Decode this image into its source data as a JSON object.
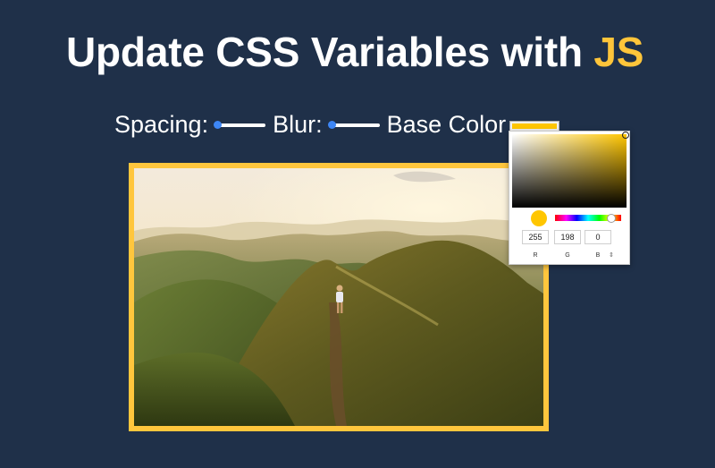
{
  "header": {
    "title_main": "Update CSS Variables with ",
    "title_highlight": "JS"
  },
  "controls": {
    "spacing_label": "Spacing:",
    "spacing_value": 0,
    "blur_label": "Blur:",
    "blur_value": 0,
    "base_color_label": "Base Color",
    "base_color": "#ffc600"
  },
  "color_picker": {
    "r": "255",
    "g": "198",
    "b": "0",
    "r_label": "R",
    "g_label": "G",
    "b_label": "B",
    "mode_toggle_icon": "up-down-arrows-icon"
  },
  "colors": {
    "background": "#1f3049",
    "accent": "#ffc53a",
    "slider_thumb": "#3d86f5"
  }
}
